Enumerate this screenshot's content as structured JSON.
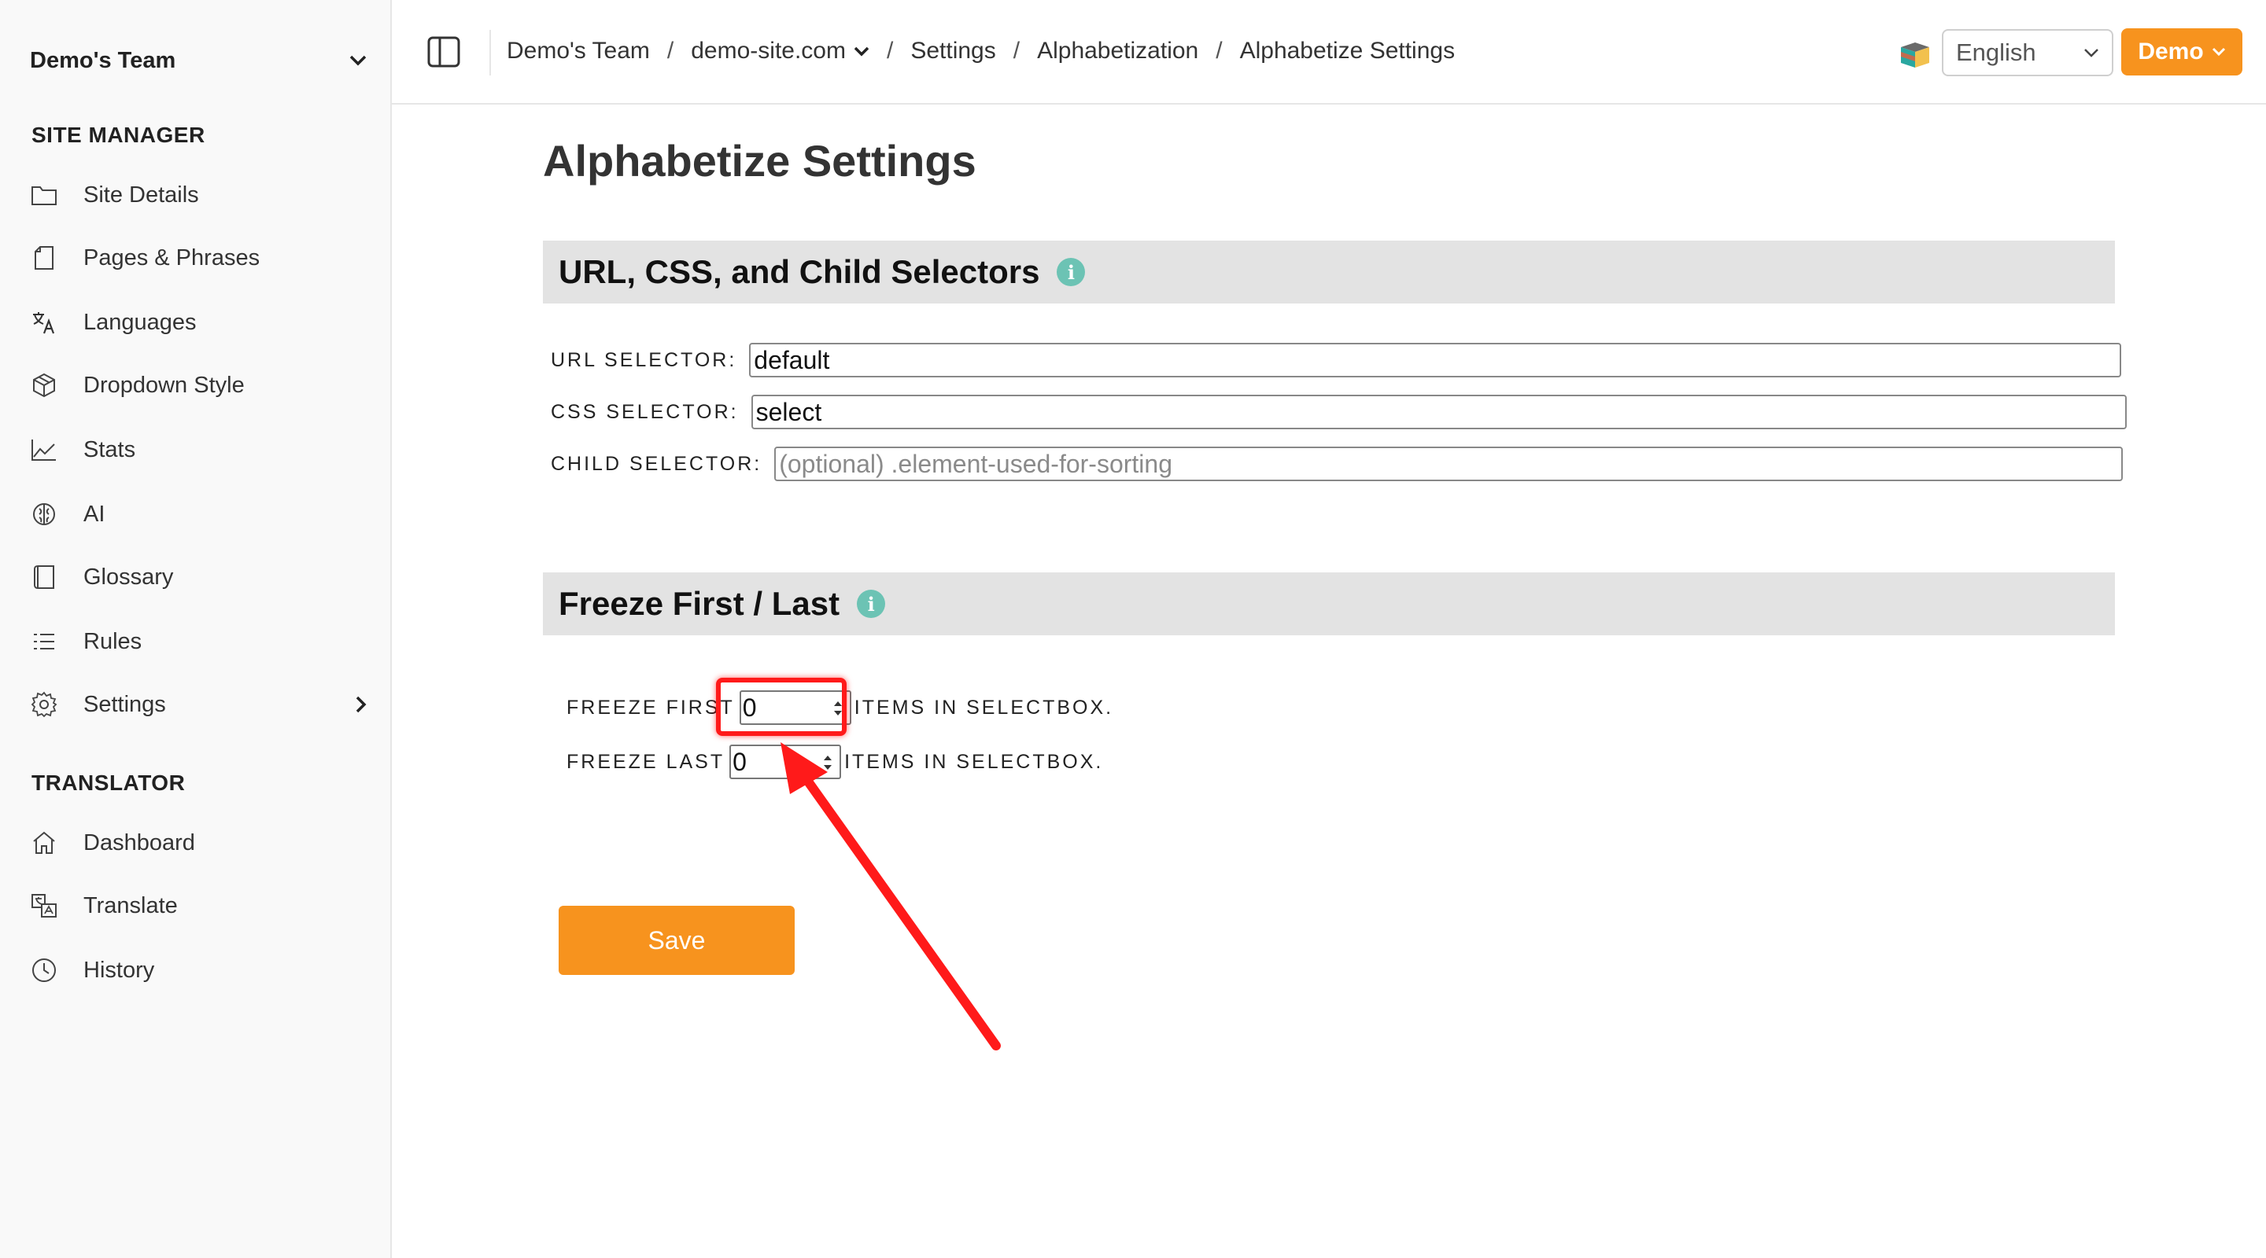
{
  "sidebar": {
    "team_name": "Demo's Team",
    "site_manager_title": "SITE MANAGER",
    "site_manager_items": [
      {
        "label": "Site Details",
        "icon": "folder-icon"
      },
      {
        "label": "Pages & Phrases",
        "icon": "page-icon"
      },
      {
        "label": "Languages",
        "icon": "translate-icon"
      },
      {
        "label": "Dropdown Style",
        "icon": "cube-icon"
      },
      {
        "label": "Stats",
        "icon": "chart-icon"
      },
      {
        "label": "AI",
        "icon": "brain-icon"
      },
      {
        "label": "Glossary",
        "icon": "book-icon"
      },
      {
        "label": "Rules",
        "icon": "list-icon"
      },
      {
        "label": "Settings",
        "icon": "gear-icon"
      }
    ],
    "translator_title": "TRANSLATOR",
    "translator_items": [
      {
        "label": "Dashboard",
        "icon": "home-icon"
      },
      {
        "label": "Translate",
        "icon": "translate-doc-icon"
      },
      {
        "label": "History",
        "icon": "clock-icon"
      }
    ]
  },
  "header": {
    "breadcrumbs": [
      "Demo's Team",
      "demo-site.com",
      "Settings",
      "Alphabetization",
      "Alphabetize Settings"
    ],
    "separator": "/",
    "language": "English",
    "user_button": "Demo"
  },
  "main": {
    "title": "Alphabetize Settings",
    "selectors_section": {
      "title": "URL, CSS, and Child Selectors",
      "info": "i",
      "url_label": "URL SELECTOR:",
      "url_value": "default",
      "css_label": "CSS SELECTOR:",
      "css_value": "select",
      "child_label": "CHILD SELECTOR:",
      "child_placeholder": "(optional) .element-used-for-sorting"
    },
    "freeze_section": {
      "title": "Freeze First / Last",
      "info": "i",
      "first_label": "FREEZE FIRST",
      "first_value": "0",
      "first_suffix": "ITEMS IN SELECTBOX.",
      "last_label": "FREEZE LAST",
      "last_value": "0",
      "last_suffix": "ITEMS IN SELECTBOX."
    },
    "save_label": "Save"
  },
  "colors": {
    "accent": "#f7931e",
    "info": "#6cc3b4",
    "annotation": "#ff1a1a"
  }
}
